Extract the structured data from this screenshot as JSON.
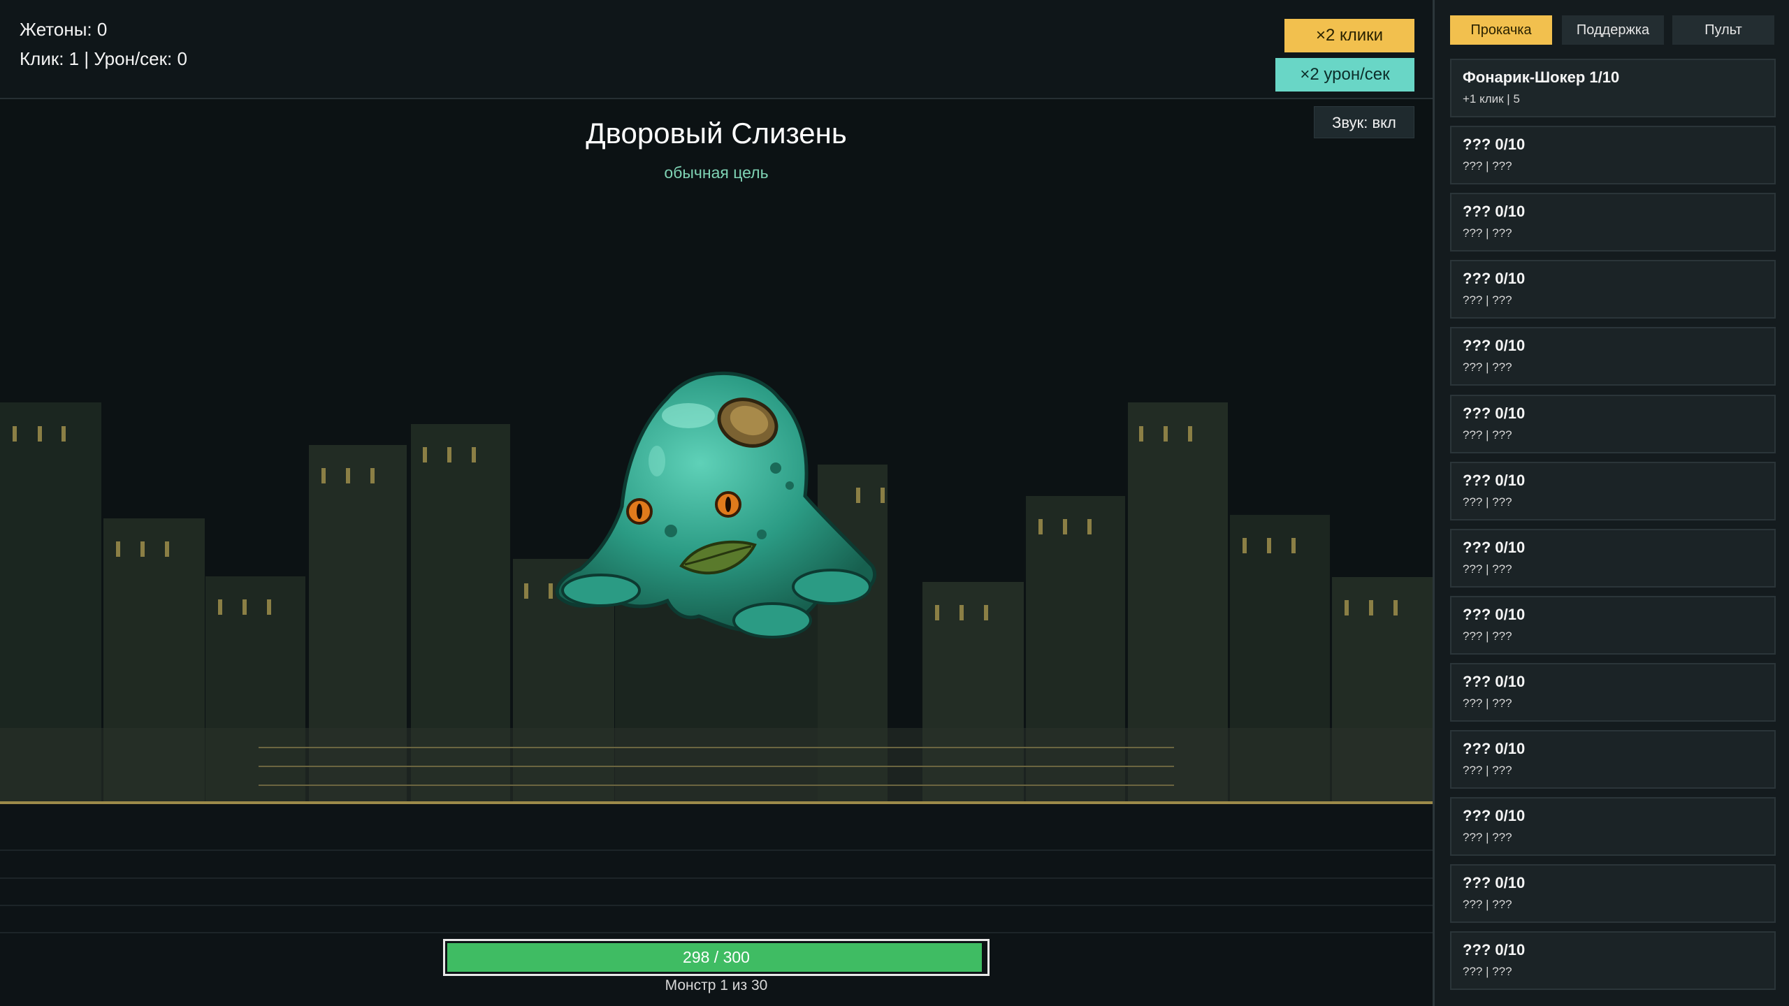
{
  "hud": {
    "tokens": "Жетоны: 0",
    "rates": "Клик: 1 | Урон/сек: 0",
    "x2_clicks_label": "×2 клики",
    "x2_dps_label": "×2 урон/сек",
    "sound_label": "Звук: вкл"
  },
  "monster": {
    "name": "Дворовый Слизень",
    "type": "обычная цель",
    "hp_text": "298 / 300",
    "hp_current": 298,
    "hp_max": 300,
    "counter": "Монстр 1 из 30"
  },
  "side": {
    "tabs": [
      {
        "label": "Прокачка",
        "active": true
      },
      {
        "label": "Поддержка",
        "active": false
      },
      {
        "label": "Пульт",
        "active": false
      }
    ],
    "upgrades": [
      {
        "name": "Фонарик-Шокер 1/10",
        "desc": "+1 клик | 5"
      },
      {
        "name": "??? 0/10",
        "desc": "??? | ???"
      },
      {
        "name": "??? 0/10",
        "desc": "??? | ???"
      },
      {
        "name": "??? 0/10",
        "desc": "??? | ???"
      },
      {
        "name": "??? 0/10",
        "desc": "??? | ???"
      },
      {
        "name": "??? 0/10",
        "desc": "??? | ???"
      },
      {
        "name": "??? 0/10",
        "desc": "??? | ???"
      },
      {
        "name": "??? 0/10",
        "desc": "??? | ???"
      },
      {
        "name": "??? 0/10",
        "desc": "??? | ???"
      },
      {
        "name": "??? 0/10",
        "desc": "??? | ???"
      },
      {
        "name": "??? 0/10",
        "desc": "??? | ???"
      },
      {
        "name": "??? 0/10",
        "desc": "??? | ???"
      },
      {
        "name": "??? 0/10",
        "desc": "??? | ???"
      },
      {
        "name": "??? 0/10",
        "desc": "??? | ???"
      }
    ]
  },
  "colors": {
    "accent_gold": "#f2c04e",
    "accent_teal": "#69d6c6",
    "hp_green": "#3fbc63",
    "slime": "#2fa88f"
  }
}
